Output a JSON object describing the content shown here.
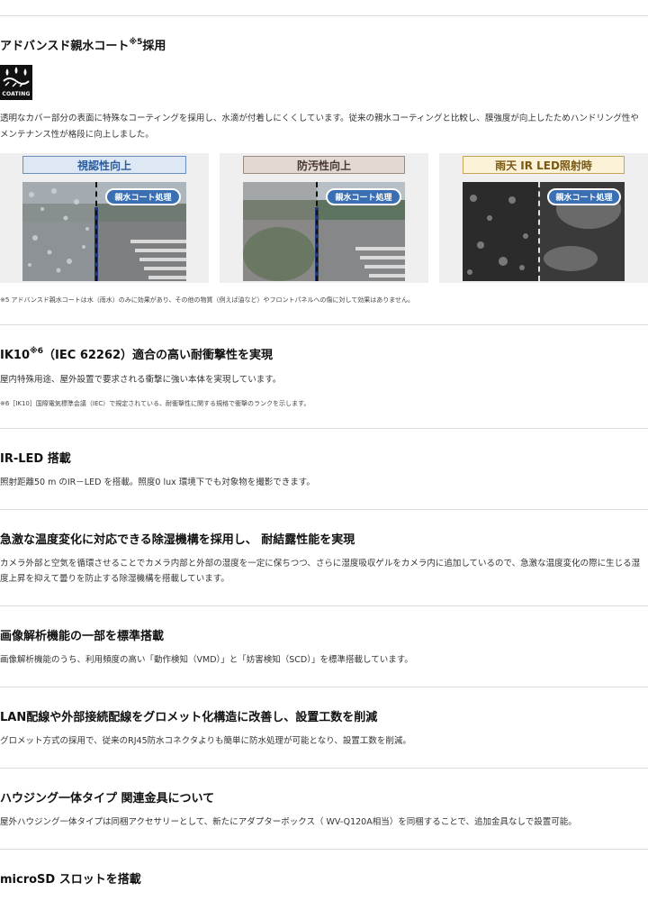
{
  "sections": {
    "coating": {
      "title_main": "アドバンスド親水コート",
      "title_sup": "※5",
      "title_end": "採用",
      "icon_label": "COATING",
      "desc_line1": "透明なカバー部分の表面に特殊なコーティングを採用し、水滴が付着しにくくしています。従来の親水コーティングと比較し、膜強度が向上したためハンドリング性や",
      "desc_line2": "メンテナンス性が格段に向上しました。",
      "panels": [
        {
          "label": "視認性向上",
          "badge": "親水コート処理"
        },
        {
          "label": "防汚性向上",
          "badge": "親水コート処理"
        },
        {
          "label": "雨天 IR LED照射時",
          "badge": "親水コート処理"
        }
      ],
      "footnote": "※5 アドバンスド親水コートは水（雨水）のみに効果があり、その他の物質（例えば油など）やフロントパネルへの傷に対して効果はありません。"
    },
    "ik10": {
      "title_main": "IK10",
      "title_sup": "※6",
      "title_end": "（IEC 62262）適合の高い耐衝撃性を実現",
      "desc": "屋内特殊用途、屋外設置で要求される衝撃に強い本体を実現しています。",
      "footnote": "※6［IK10］国際電気標準会議（IEC）で規定されている、耐衝撃性に関する規格で衝撃のランクを示します。"
    },
    "irled": {
      "title": "IR-LED 搭載",
      "desc": "照射距離50 m のIR－LED を搭載。照度0 lux 環境下でも対象物を撮影できます。"
    },
    "dehumid": {
      "title": "急激な温度変化に対応できる除湿機構を採用し、 耐結露性能を実現",
      "desc_line1": "カメラ外部と空気を循環させることでカメラ内部と外部の湿度を一定に保ちつつ、さらに湿度吸収ゲルをカメラ内に追加しているので、急激な温度変化の際に生じる湿",
      "desc_line2": "度上昇を抑えて曇りを防止する除湿機構を搭載しています。"
    },
    "analytics": {
      "title": "画像解析機能の一部を標準搭載",
      "desc": "画像解析機能のうち、利用頻度の高い「動作検知（VMD）」と「妨害検知（SCD）」を標準搭載しています。"
    },
    "grommet": {
      "title": "LAN配線や外部接続配線をグロメット化構造に改善し、設置工数を削減",
      "desc": "グロメット方式の採用で、従来のRJ45防水コネクタよりも簡単に防水処理が可能となり、設置工数を削減。"
    },
    "housing": {
      "title": "ハウジング一体タイプ 関連金具について",
      "desc": "屋外ハウジング一体タイプは同梱アクセサリーとして、新たにアダプターボックス（ WV-Q120A相当）を同梱することで、追加金具なしで設置可能。"
    },
    "microsd": {
      "title": "microSD スロットを搭載"
    }
  },
  "colors": {
    "panel1_border": "#6a8fbf",
    "panel1_bg": "#dde8f4",
    "panel1_text": "#2a5b9c",
    "panel2_border": "#9c8e86",
    "panel2_bg": "#e2d9d3",
    "panel2_text": "#4a3a30",
    "panel3_border": "#c6a45a",
    "panel3_bg": "#fbf2d8",
    "panel3_text": "#7a5810",
    "badge": "#3a6fb4"
  }
}
